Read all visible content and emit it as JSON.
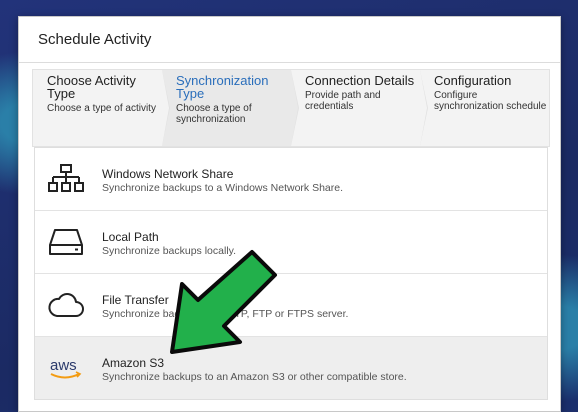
{
  "dialog": {
    "title": "Schedule Activity"
  },
  "steps": [
    {
      "title": "Choose Activity Type",
      "subtitle": "Choose a type of activity",
      "active": false
    },
    {
      "title": "Synchronization Type",
      "subtitle": "Choose a type of synchronization",
      "active": true
    },
    {
      "title": "Connection Details",
      "subtitle": "Provide path and credentials",
      "active": false
    },
    {
      "title": "Configuration",
      "subtitle": "Configure synchronization schedule",
      "active": false
    }
  ],
  "options": [
    {
      "title": "Windows Network Share",
      "description": "Synchronize backups to a Windows Network Share.",
      "icon": "network-share-icon"
    },
    {
      "title": "Local Path",
      "description": "Synchronize backups locally.",
      "icon": "hard-drive-icon"
    },
    {
      "title": "File Transfer",
      "description": "Synchronize backups via SFTP, FTP or FTPS server.",
      "icon": "cloud-icon"
    },
    {
      "title": "Amazon S3",
      "description": "Synchronize backups to an Amazon S3 or other compatible store.",
      "icon": "aws-icon",
      "selected": true
    }
  ],
  "aws_logo_text": "aws",
  "colors": {
    "accent": "#2a6ebb",
    "arrow": "#22b04b"
  }
}
